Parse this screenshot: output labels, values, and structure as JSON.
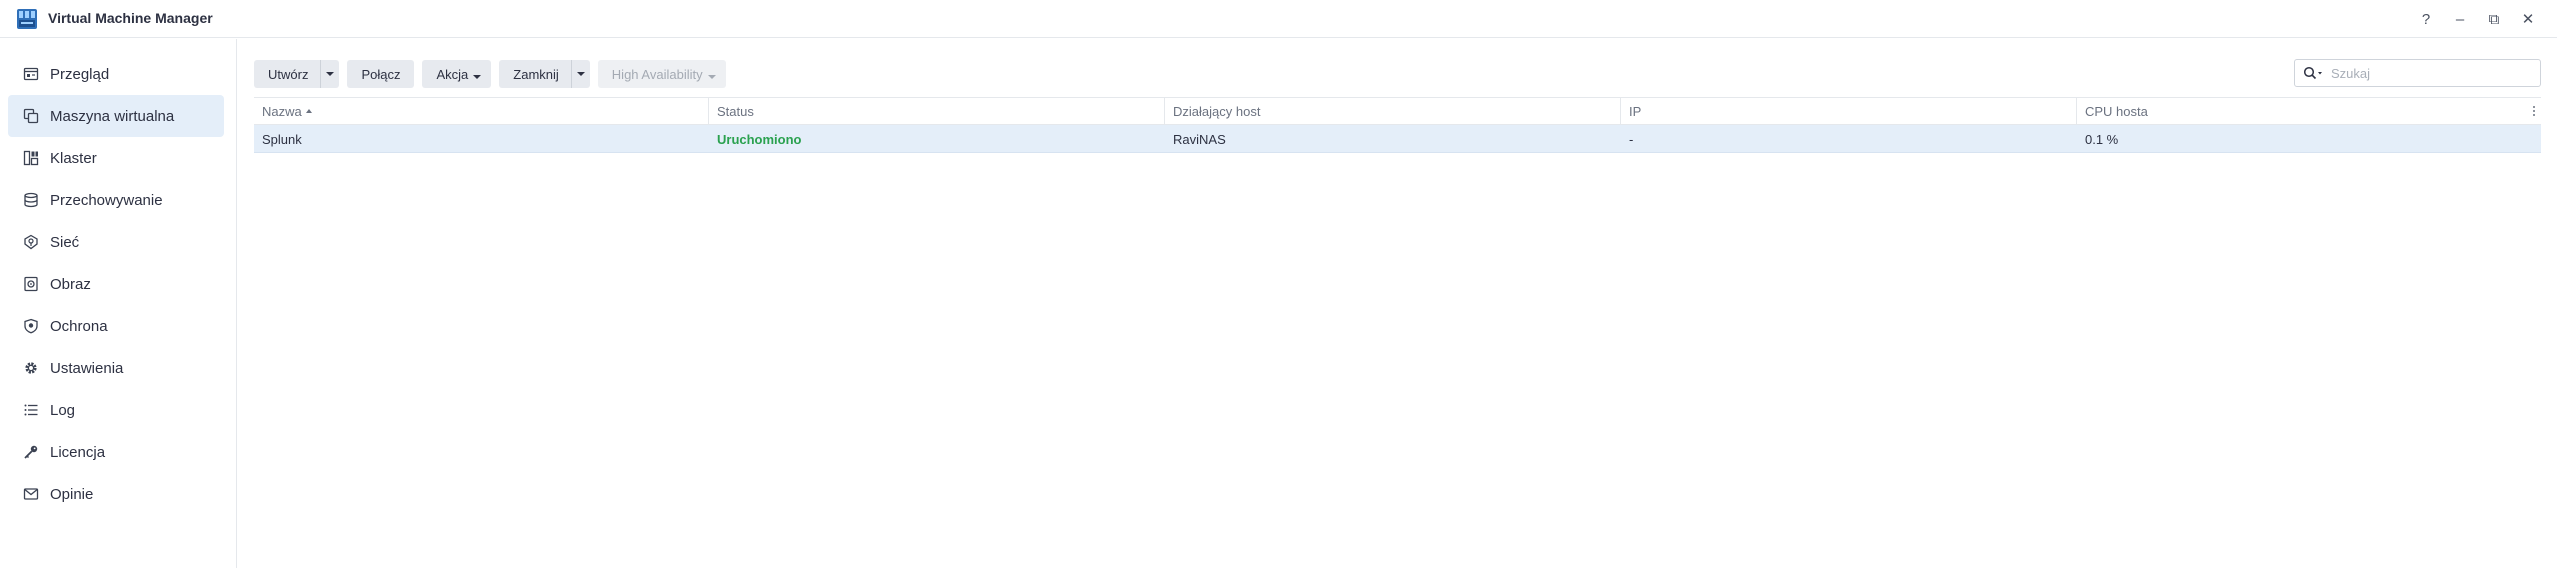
{
  "window": {
    "title": "Virtual Machine Manager",
    "controls": [
      {
        "name": "help-icon",
        "glyph": "?"
      },
      {
        "name": "minimize-icon",
        "glyph": "–"
      },
      {
        "name": "restore-icon",
        "glyph": "⧉"
      },
      {
        "name": "close-icon",
        "glyph": "✕"
      }
    ]
  },
  "sidebar": {
    "items": [
      {
        "label": "Przegląd",
        "icon": "overview-icon",
        "active": false
      },
      {
        "label": "Maszyna wirtualna",
        "icon": "virtual-machine-icon",
        "active": true
      },
      {
        "label": "Klaster",
        "icon": "cluster-icon",
        "active": false
      },
      {
        "label": "Przechowywanie",
        "icon": "storage-icon",
        "active": false
      },
      {
        "label": "Sieć",
        "icon": "network-icon",
        "active": false
      },
      {
        "label": "Obraz",
        "icon": "image-icon",
        "active": false
      },
      {
        "label": "Ochrona",
        "icon": "shield-icon",
        "active": false
      },
      {
        "label": "Ustawienia",
        "icon": "gear-icon",
        "active": false
      },
      {
        "label": "Log",
        "icon": "list-icon",
        "active": false
      },
      {
        "label": "Licencja",
        "icon": "key-icon",
        "active": false
      },
      {
        "label": "Opinie",
        "icon": "mail-icon",
        "active": false
      }
    ]
  },
  "toolbar": {
    "create_label": "Utwórz",
    "connect_label": "Połącz",
    "action_label": "Akcja",
    "shutdown_label": "Zamknij",
    "ha_label": "High Availability"
  },
  "search": {
    "placeholder": "Szukaj",
    "value": ""
  },
  "table": {
    "columns": [
      "Nazwa",
      "Status",
      "Działający host",
      "IP",
      "CPU hosta"
    ],
    "sorted_column": "Nazwa",
    "rows": [
      {
        "name": "Splunk",
        "status": "Uruchomiono",
        "host": "RaviNAS",
        "ip": "-",
        "cpu": "0.1 %",
        "selected": true
      }
    ]
  },
  "colors": {
    "accent": "#e4eef9",
    "status_running": "#2aa14f",
    "text": "#2d3142",
    "muted": "#6b7280"
  }
}
